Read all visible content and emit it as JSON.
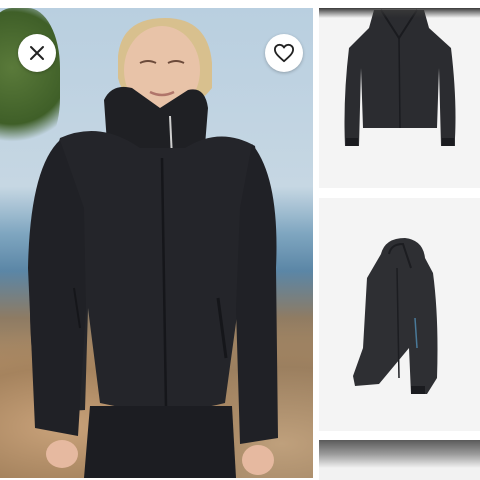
{
  "gallery": {
    "main_image": {
      "icon": "woman-in-black-jacket-photo"
    },
    "close_button": {
      "icon": "close-icon"
    },
    "favorite_button": {
      "icon": "heart-icon"
    },
    "thumbnails": [
      {
        "icon": "jacket-front-view"
      },
      {
        "icon": "jacket-side-view"
      },
      {
        "icon": "jacket-partial-view"
      }
    ]
  },
  "colors": {
    "jacket": "#232428",
    "button_bg": "#ffffff",
    "thumb_bg": "#f4f4f4"
  }
}
